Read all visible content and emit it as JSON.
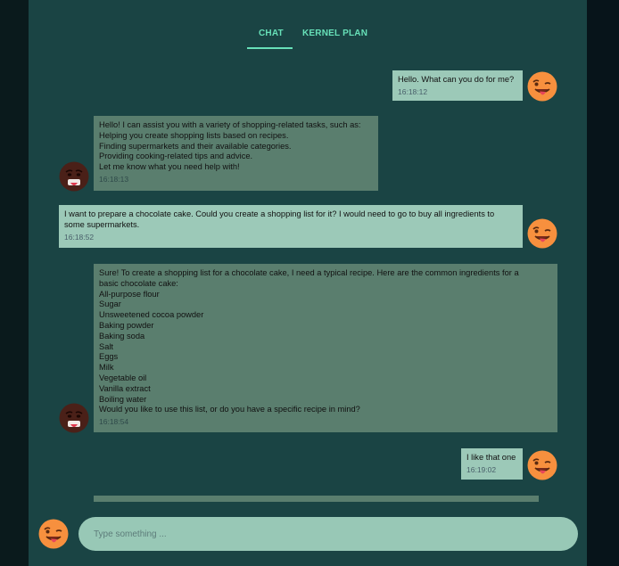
{
  "tabs": [
    {
      "label": "CHAT",
      "active": true
    },
    {
      "label": "KERNEL PLAN",
      "active": false
    }
  ],
  "colors": {
    "accent": "#67e0b8",
    "panel_bg": "#1a4444",
    "user_bubble": "#9cc9b8",
    "bot_bubble": "#5a7e6e",
    "input_bg": "#98c8b6"
  },
  "messages": [
    {
      "role": "user",
      "avatar_icon": "winking-face-with-tongue-icon",
      "text": "Hello. What can you do for me?",
      "time": "16:18:12"
    },
    {
      "role": "bot",
      "avatar_icon": "dark-face-tongue-icon",
      "text": "Hello! I can assist you with a variety of shopping-related tasks, such as:\nHelping you create shopping lists based on recipes.\nFinding supermarkets and their available categories.\nProviding cooking-related tips and advice.\nLet me know what you need help with!",
      "time": "16:18:13"
    },
    {
      "role": "user",
      "avatar_icon": "winking-face-with-tongue-icon",
      "text": "I want to prepare a chocolate cake. Could you create a shopping list for it? I would need to go to buy all ingredients to\nsome supermarkets.",
      "time": "16:18:52"
    },
    {
      "role": "bot",
      "avatar_icon": "dark-face-tongue-icon",
      "text": "Sure! To create a shopping list for a chocolate cake, I need a typical recipe. Here are the common ingredients for a\nbasic chocolate cake:\nAll-purpose flour\nSugar\nUnsweetened cocoa powder\nBaking powder\nBaking soda\nSalt\nEggs\nMilk\nVegetable oil\nVanilla extract\nBoiling water\nWould you like to use this list, or do you have a specific recipe in mind?",
      "time": "16:18:54"
    },
    {
      "role": "user",
      "avatar_icon": "winking-face-with-tongue-icon",
      "text": "I like that one",
      "time": "16:19:02"
    }
  ],
  "input": {
    "placeholder": "Type something ...",
    "value": "",
    "avatar_icon": "winking-face-with-tongue-icon"
  }
}
